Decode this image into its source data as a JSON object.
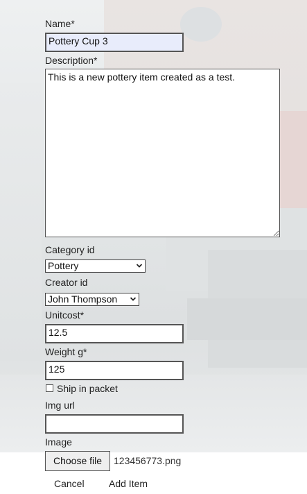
{
  "form": {
    "name_label": "Name*",
    "name_value": "Pottery Cup 3",
    "description_label": "Description*",
    "description_value": "This is a new pottery item created as a test.",
    "category_label": "Category id",
    "category_selected": "Pottery",
    "creator_label": "Creator id",
    "creator_selected": "John Thompson",
    "unitcost_label": "Unitcost*",
    "unitcost_value": "12.5",
    "weight_label": "Weight g*",
    "weight_value": "125",
    "ship_label": "Ship in packet",
    "ship_checked": false,
    "imgurl_label": "Img url",
    "imgurl_value": "",
    "image_label": "Image",
    "choose_file_label": "Choose file",
    "file_name": "123456773.png"
  },
  "actions": {
    "cancel_label": "Cancel",
    "add_label": "Add Item"
  },
  "icons": {
    "select_arrow": "chevron-down-icon",
    "resize_handle": "resize-grip-icon"
  }
}
